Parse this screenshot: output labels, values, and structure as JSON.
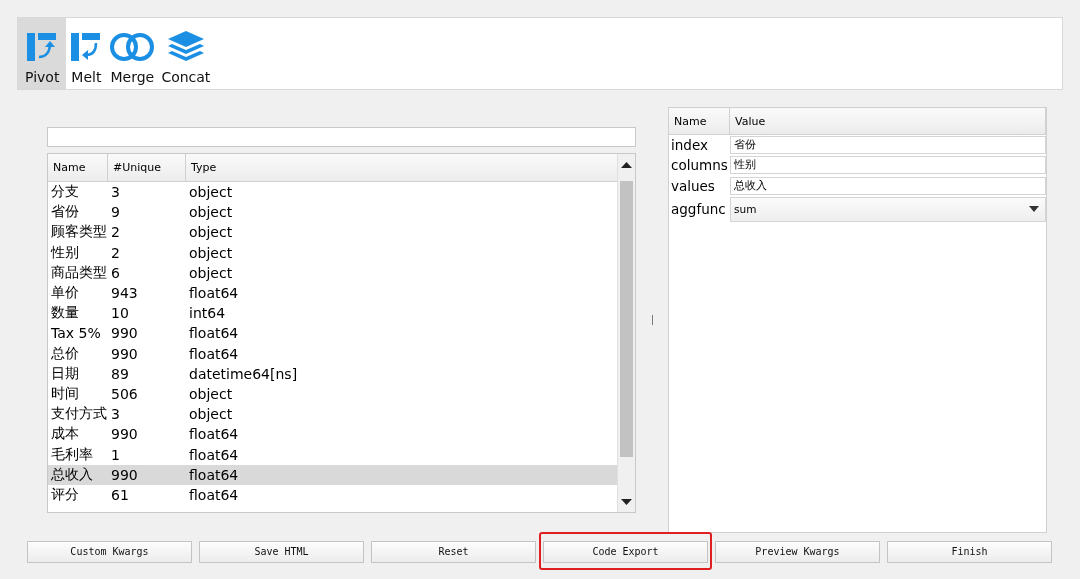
{
  "toolbar": {
    "items": [
      {
        "kind": "pivot",
        "label": "Pivot",
        "selected": true
      },
      {
        "kind": "melt",
        "label": "Melt",
        "selected": false
      },
      {
        "kind": "merge",
        "label": "Merge",
        "selected": false
      },
      {
        "kind": "concat",
        "label": "Concat",
        "selected": false
      }
    ]
  },
  "columns_table": {
    "columns": [
      "Name",
      "#Unique",
      "Type"
    ],
    "rows": [
      {
        "name": "分支",
        "unique": "3",
        "type": "object",
        "selected": false
      },
      {
        "name": "省份",
        "unique": "9",
        "type": "object",
        "selected": false
      },
      {
        "name": "顾客类型",
        "unique": "2",
        "type": "object",
        "selected": false
      },
      {
        "name": "性别",
        "unique": "2",
        "type": "object",
        "selected": false
      },
      {
        "name": "商品类型",
        "unique": "6",
        "type": "object",
        "selected": false
      },
      {
        "name": "单价",
        "unique": "943",
        "type": "float64",
        "selected": false
      },
      {
        "name": "数量",
        "unique": "10",
        "type": "int64",
        "selected": false
      },
      {
        "name": "Tax 5%",
        "unique": "990",
        "type": "float64",
        "selected": false
      },
      {
        "name": "总价",
        "unique": "990",
        "type": "float64",
        "selected": false
      },
      {
        "name": "日期",
        "unique": "89",
        "type": "datetime64[ns]",
        "selected": false
      },
      {
        "name": "时间",
        "unique": "506",
        "type": "object",
        "selected": false
      },
      {
        "name": "支付方式",
        "unique": "3",
        "type": "object",
        "selected": false
      },
      {
        "name": "成本",
        "unique": "990",
        "type": "float64",
        "selected": false
      },
      {
        "name": "毛利率",
        "unique": "1",
        "type": "float64",
        "selected": false
      },
      {
        "name": "总收入",
        "unique": "990",
        "type": "float64",
        "selected": true
      },
      {
        "name": "评分",
        "unique": "61",
        "type": "float64",
        "selected": false
      }
    ]
  },
  "kwargs_table": {
    "columns": [
      "Name",
      "Value"
    ],
    "rows": [
      {
        "name": "index",
        "kind": "text",
        "value": "省份"
      },
      {
        "name": "columns",
        "kind": "text",
        "value": "性别"
      },
      {
        "name": "values",
        "kind": "text",
        "value": "总收入"
      },
      {
        "name": "aggfunc",
        "kind": "dropdown",
        "value": "sum"
      }
    ]
  },
  "buttons": [
    {
      "label": "Custom Kwargs",
      "highlighted": false
    },
    {
      "label": "Save HTML",
      "highlighted": false
    },
    {
      "label": "Reset",
      "highlighted": false
    },
    {
      "label": "Code Export",
      "highlighted": true
    },
    {
      "label": "Preview Kwargs",
      "highlighted": false
    },
    {
      "label": "Finish",
      "highlighted": false
    }
  ]
}
